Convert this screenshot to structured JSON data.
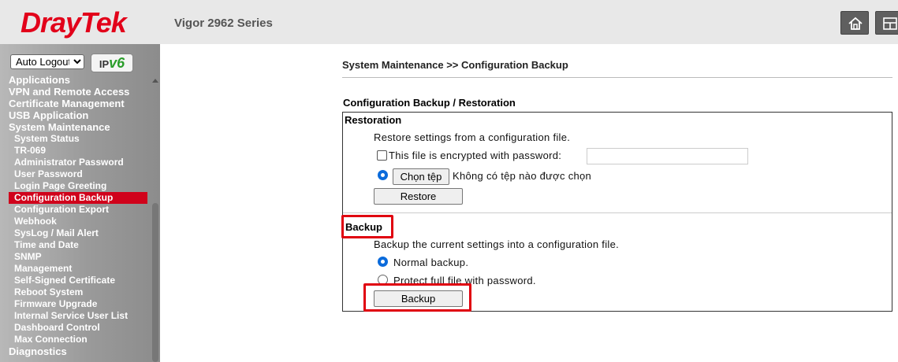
{
  "header": {
    "logo_text": "DrayTek",
    "model": "Vigor 2962 Series",
    "icons": [
      "home-icon",
      "layout-icon"
    ]
  },
  "sidebar": {
    "logout_select": "Auto Logout",
    "ipv6_badge": "IPv6",
    "menu": [
      {
        "label": "Applications",
        "level": "top"
      },
      {
        "label": "VPN and Remote Access",
        "level": "top"
      },
      {
        "label": "Certificate Management",
        "level": "top"
      },
      {
        "label": "USB Application",
        "level": "top"
      },
      {
        "label": "System Maintenance",
        "level": "top"
      },
      {
        "label": "System Status",
        "level": "sub"
      },
      {
        "label": "TR-069",
        "level": "sub"
      },
      {
        "label": "Administrator Password",
        "level": "sub"
      },
      {
        "label": "User Password",
        "level": "sub"
      },
      {
        "label": "Login Page Greeting",
        "level": "sub"
      },
      {
        "label": "Configuration Backup",
        "level": "sub",
        "active": true
      },
      {
        "label": "Configuration Export",
        "level": "sub"
      },
      {
        "label": "Webhook",
        "level": "sub"
      },
      {
        "label": "SysLog / Mail Alert",
        "level": "sub"
      },
      {
        "label": "Time and Date",
        "level": "sub"
      },
      {
        "label": "SNMP",
        "level": "sub"
      },
      {
        "label": "Management",
        "level": "sub"
      },
      {
        "label": "Self-Signed Certificate",
        "level": "sub"
      },
      {
        "label": "Reboot System",
        "level": "sub"
      },
      {
        "label": "Firmware Upgrade",
        "level": "sub"
      },
      {
        "label": "Internal Service User List",
        "level": "sub"
      },
      {
        "label": "Dashboard Control",
        "level": "sub"
      },
      {
        "label": "Max Connection",
        "level": "sub"
      },
      {
        "label": "Diagnostics",
        "level": "top"
      }
    ]
  },
  "main": {
    "breadcrumb": "System Maintenance >> Configuration Backup",
    "section_title": "Configuration Backup / Restoration",
    "restoration": {
      "heading": "Restoration",
      "description": "Restore settings from a configuration file.",
      "encrypted_label": "This file is encrypted with password:",
      "encrypted_checked": false,
      "password_value": "",
      "choose_file_button": "Chọn tệp",
      "no_file_text": "Không có tệp nào được chọn",
      "restore_button": "Restore"
    },
    "backup": {
      "heading": "Backup",
      "description": "Backup the current settings into a configuration file.",
      "normal_option": "Normal backup.",
      "protect_option": "Protect full file with password.",
      "selected": "normal",
      "backup_button": "Backup"
    }
  },
  "colors": {
    "brand_red": "#e2001a",
    "active_menu": "#d0021b",
    "highlight": "#e0000f",
    "radio_blue": "#0b6bdb"
  }
}
